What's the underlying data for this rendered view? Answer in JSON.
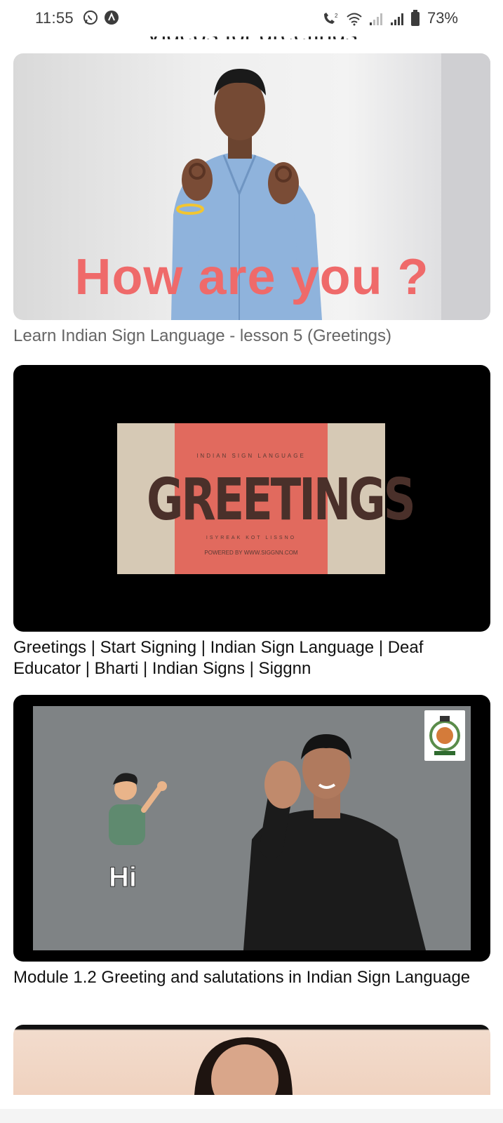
{
  "status_bar": {
    "time": "11:55",
    "battery": "73%",
    "left_icons": [
      "whatsapp-icon",
      "app-notification-icon"
    ],
    "right_icons": [
      "volte-call-icon",
      "wifi-icon",
      "signal-weak-icon",
      "signal-icon",
      "battery-icon"
    ]
  },
  "section": {
    "heading": "Videos for greetings"
  },
  "videos": [
    {
      "overlay_text": "How are you ?",
      "title": "Learn Indian Sign Language - lesson 5 (Greetings)"
    },
    {
      "card_top": "INDIAN SIGN LANGUAGE",
      "card_word": "GREETINGS",
      "card_sub": "ISYREAK KOT LISSNO",
      "card_powered": "POWERED BY WWW.SIGGNN.COM",
      "title": "Greetings | Start Signing | Indian Sign Language | Deaf Educator | Bharti  | Indian Signs | Siggnn"
    },
    {
      "overlay_text": "Hi",
      "title": "Module 1.2 Greeting and salutations in Indian Sign Language"
    },
    {
      "title": ""
    }
  ]
}
